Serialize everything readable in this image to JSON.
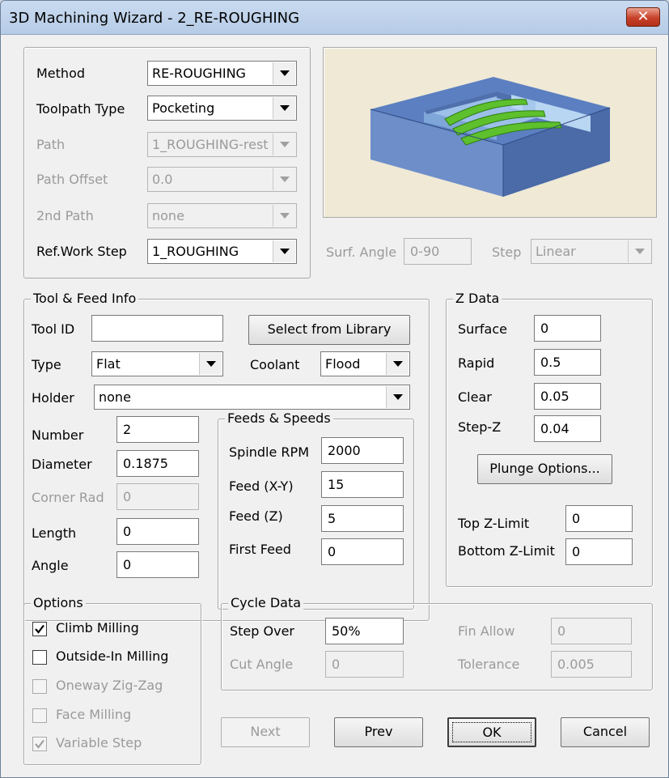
{
  "window": {
    "title": "3D Machining Wizard - 2_RE-ROUGHING",
    "close_symbol": "✕"
  },
  "method_panel": {
    "method": {
      "label": "Method",
      "value": "RE-ROUGHING"
    },
    "toolpath_type": {
      "label": "Toolpath Type",
      "value": "Pocketing"
    },
    "path": {
      "label": "Path",
      "value": "1_ROUGHING-rest"
    },
    "path_offset": {
      "label": "Path Offset",
      "value": "0.0"
    },
    "second_path": {
      "label": "2nd Path",
      "value": "none"
    },
    "ref_work_step": {
      "label": "Ref.Work Step",
      "value": "1_ROUGHING"
    }
  },
  "surface": {
    "surf_angle_label": "Surf. Angle",
    "surf_angle_value": "0-90",
    "step_label": "Step",
    "step_value": "Linear"
  },
  "tool_feed": {
    "title": "Tool & Feed Info",
    "tool_id_label": "Tool ID",
    "tool_id_value": "",
    "select_library_label": "Select from Library",
    "type_label": "Type",
    "type_value": "Flat",
    "coolant_label": "Coolant",
    "coolant_value": "Flood",
    "holder_label": "Holder",
    "holder_value": "none",
    "number_label": "Number",
    "number_value": "2",
    "diameter_label": "Diameter",
    "diameter_value": "0.1875",
    "corner_rad_label": "Corner Rad",
    "corner_rad_value": "0",
    "length_label": "Length",
    "length_value": "0",
    "angle_label": "Angle",
    "angle_value": "0"
  },
  "feeds_speeds": {
    "title": "Feeds & Speeds",
    "spindle_label": "Spindle RPM",
    "spindle_value": "2000",
    "feed_xy_label": "Feed (X-Y)",
    "feed_xy_value": "15",
    "feed_z_label": "Feed (Z)",
    "feed_z_value": "5",
    "first_feed_label": "First Feed",
    "first_feed_value": "0"
  },
  "z_data": {
    "title": "Z Data",
    "surface_label": "Surface",
    "surface_value": "0",
    "rapid_label": "Rapid",
    "rapid_value": "0.5",
    "clear_label": "Clear",
    "clear_value": "0.05",
    "stepz_label": "Step-Z",
    "stepz_value": "0.04",
    "plunge_label": "Plunge Options...",
    "top_z_label": "Top Z-Limit",
    "top_z_value": "0",
    "bottom_z_label": "Bottom Z-Limit",
    "bottom_z_value": "0"
  },
  "options": {
    "title": "Options",
    "items": [
      {
        "label": "Climb Milling",
        "checked": true,
        "enabled": true
      },
      {
        "label": "Outside-In Milling",
        "checked": false,
        "enabled": true
      },
      {
        "label": "Oneway Zig-Zag",
        "checked": false,
        "enabled": false
      },
      {
        "label": "Face Milling",
        "checked": false,
        "enabled": false
      },
      {
        "label": "Variable Step",
        "checked": true,
        "enabled": false
      }
    ]
  },
  "cycle_data": {
    "title": "Cycle Data",
    "step_over_label": "Step Over",
    "step_over_value": "50%",
    "cut_angle_label": "Cut Angle",
    "cut_angle_value": "0",
    "fin_allow_label": "Fin Allow",
    "fin_allow_value": "0",
    "tolerance_label": "Tolerance",
    "tolerance_value": "0.005"
  },
  "buttons": {
    "next": "Next",
    "prev": "Prev",
    "ok": "OK",
    "cancel": "Cancel"
  },
  "colors": {
    "title_bar": "#c2d5ee",
    "close_button": "#c8412a",
    "preview_bg": "#efe9d6",
    "toolpath_green": "#5dc02c",
    "block_blue": "#5b7fc0"
  }
}
